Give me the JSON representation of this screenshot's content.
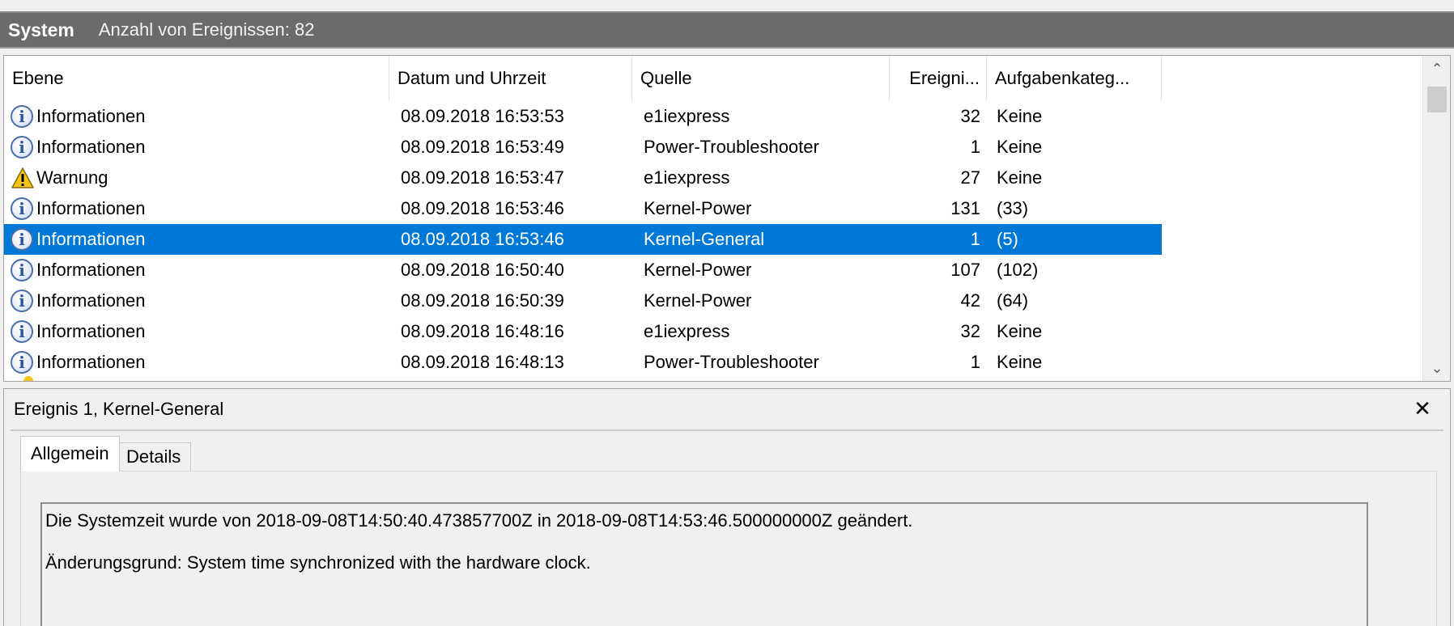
{
  "header": {
    "title": "System",
    "count_label": "Anzahl von Ereignissen: 82"
  },
  "columns": [
    "Ebene",
    "Datum und Uhrzeit",
    "Quelle",
    "Ereigni...",
    "Aufgabenkateg..."
  ],
  "rows": [
    {
      "level": "Informationen",
      "icon": "info-icon",
      "date": "08.09.2018 16:53:53",
      "source": "e1iexpress",
      "id": "32",
      "task": "Keine"
    },
    {
      "level": "Informationen",
      "icon": "info-icon",
      "date": "08.09.2018 16:53:49",
      "source": "Power-Troubleshooter",
      "id": "1",
      "task": "Keine"
    },
    {
      "level": "Warnung",
      "icon": "warning-icon",
      "date": "08.09.2018 16:53:47",
      "source": "e1iexpress",
      "id": "27",
      "task": "Keine"
    },
    {
      "level": "Informationen",
      "icon": "info-icon",
      "date": "08.09.2018 16:53:46",
      "source": "Kernel-Power",
      "id": "131",
      "task": "(33)"
    },
    {
      "level": "Informationen",
      "icon": "info-icon",
      "date": "08.09.2018 16:53:46",
      "source": "Kernel-General",
      "id": "1",
      "task": "(5)",
      "selected": true
    },
    {
      "level": "Informationen",
      "icon": "info-icon",
      "date": "08.09.2018 16:50:40",
      "source": "Kernel-Power",
      "id": "107",
      "task": "(102)"
    },
    {
      "level": "Informationen",
      "icon": "info-icon",
      "date": "08.09.2018 16:50:39",
      "source": "Kernel-Power",
      "id": "42",
      "task": "(64)"
    },
    {
      "level": "Informationen",
      "icon": "info-icon",
      "date": "08.09.2018 16:48:16",
      "source": "e1iexpress",
      "id": "32",
      "task": "Keine"
    },
    {
      "level": "Informationen",
      "icon": "info-icon",
      "date": "08.09.2018 16:48:13",
      "source": "Power-Troubleshooter",
      "id": "1",
      "task": "Keine"
    }
  ],
  "detail": {
    "title": "Ereignis 1, Kernel-General",
    "close_label": "✕",
    "tabs": [
      "Allgemein",
      "Details"
    ],
    "active_tab": "Allgemein",
    "description_line1": "Die Systemzeit wurde von 2018-09-08T14:50:40.473857700Z in 2018-09-08T14:53:46.500000000Z geändert.",
    "description_line2": "Änderungsgrund: System time synchronized with the hardware clock."
  },
  "colors": {
    "header_bg": "#6b6b6b",
    "selection": "#0078d7",
    "info_icon": "#2a56a8",
    "warning_icon": "#f5c518"
  }
}
